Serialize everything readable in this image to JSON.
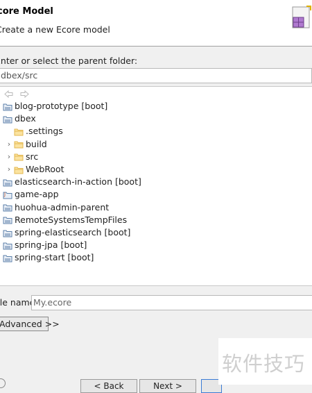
{
  "header": {
    "title": "core Model",
    "subtitle": "Create a new Ecore model",
    "icon": "wizard-package-icon"
  },
  "parent_folder": {
    "label": "Enter or select the parent folder:",
    "value": "dbex/src"
  },
  "tree": {
    "nav_back_icon": "back-arrow-icon",
    "nav_forward_icon": "forward-arrow-icon",
    "items": [
      {
        "label": "blog-prototype [boot]",
        "icon": "project-icon",
        "expandable": false
      },
      {
        "label": "dbex",
        "icon": "project-icon",
        "expandable": false
      },
      {
        "label": ".settings",
        "icon": "folder-icon",
        "expandable": false
      },
      {
        "label": "build",
        "icon": "folder-icon",
        "expandable": true
      },
      {
        "label": "src",
        "icon": "folder-icon",
        "expandable": true
      },
      {
        "label": "WebRoot",
        "icon": "folder-icon",
        "expandable": true
      },
      {
        "label": "elasticsearch-in-action [boot]",
        "icon": "project-icon",
        "expandable": false
      },
      {
        "label": "game-app",
        "icon": "java-project-icon",
        "expandable": false
      },
      {
        "label": "huohua-admin-parent",
        "icon": "project-icon",
        "expandable": false
      },
      {
        "label": "RemoteSystemsTempFiles",
        "icon": "project-icon",
        "expandable": false
      },
      {
        "label": "spring-elasticsearch [boot]",
        "icon": "project-icon",
        "expandable": false
      },
      {
        "label": "spring-jpa [boot]",
        "icon": "project-icon",
        "expandable": false
      },
      {
        "label": "spring-start [boot]",
        "icon": "project-icon",
        "expandable": false
      }
    ]
  },
  "file_name": {
    "label": "File name:",
    "value": "My.ecore"
  },
  "advanced_button": "Advanced >>",
  "watermark": "软件技巧",
  "footer": {
    "back": "< Back",
    "next": "Next >"
  },
  "colors": {
    "folder": "#e3b74f",
    "project": "#5b7fa8",
    "java_badge": "#c2572b"
  }
}
